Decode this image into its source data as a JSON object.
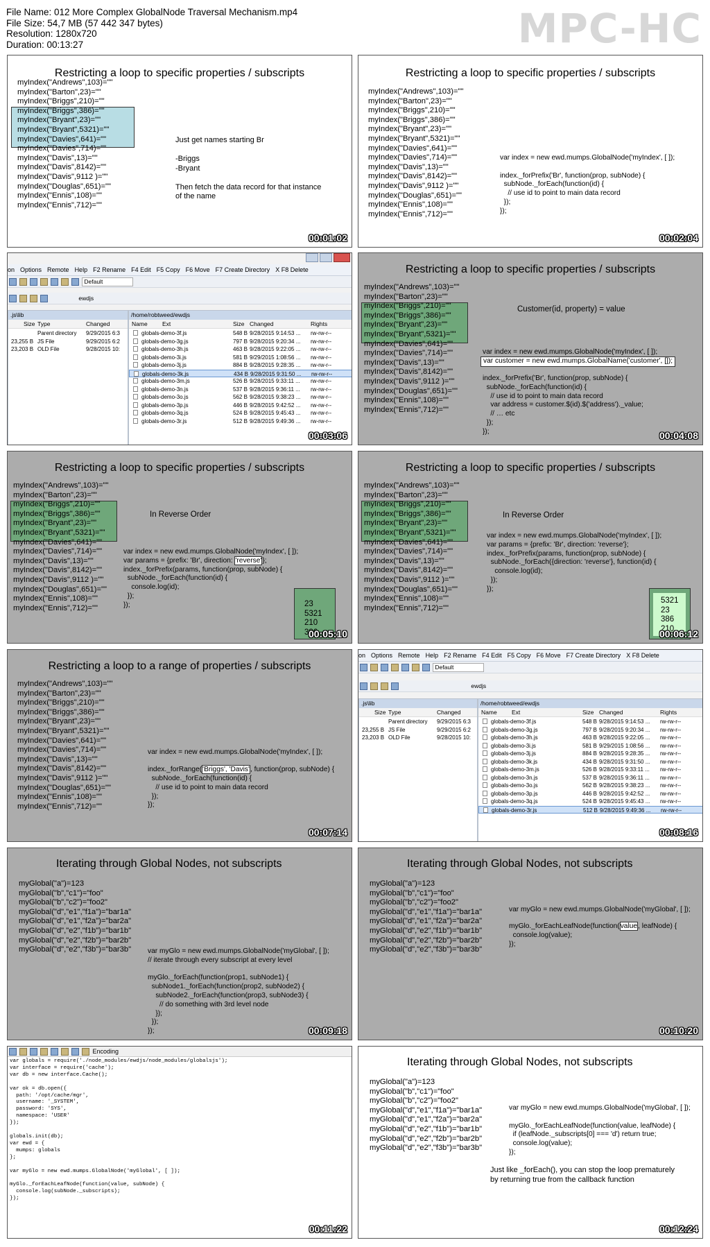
{
  "header": {
    "file_name": "File Name: 012 More Complex GlobalNode Traversal Mechanism.mp4",
    "file_size": "File Size: 54,7 MB (57 442 347 bytes)",
    "resolution": "Resolution: 1280x720",
    "duration": "Duration: 00:13:27",
    "logo": "MPC-HC"
  },
  "index_lines": [
    "myIndex(\"Andrews\",103)=\"\"",
    "myIndex(\"Barton\",23)=\"\"",
    "myIndex(\"Briggs\",210)=\"\"",
    "myIndex(\"Briggs\",386)=\"\"",
    "myIndex(\"Bryant\",23)=\"\"",
    "myIndex(\"Bryant\",5321)=\"\"",
    "myIndex(\"Davies\",641)=\"\"",
    "myIndex(\"Davies\",714)=\"\"",
    "myIndex(\"Davis\",13)=\"\"",
    "myIndex(\"Davis\",8142)=\"\"",
    "myIndex(\"Davis\",9112 )=\"\"",
    "myIndex(\"Douglas\",651)=\"\"",
    "myIndex(\"Ennis\",108)=\"\"",
    "myIndex(\"Ennis\",712)=\"\""
  ],
  "global_lines": [
    "myGlobal(\"a\")=123",
    "myGlobal(\"b\",\"c1\")=\"foo\"",
    "myGlobal(\"b\",\"c2\")=\"foo2\"",
    "myGlobal(\"d\",\"e1\",\"f1a\")=\"bar1a\"",
    "myGlobal(\"d\",\"e1\",\"f2a\")=\"bar2a\"",
    "myGlobal(\"d\",\"e2\",\"f1b\")=\"bar1b\"",
    "myGlobal(\"d\",\"e2\",\"f2b\")=\"bar2b\"",
    "myGlobal(\"d\",\"e2\",\"f3b\")=\"bar3b\""
  ],
  "titles": {
    "restrict": "Restricting a loop to specific properties / subscripts",
    "range": "Restricting a loop to a range of properties / subscripts",
    "iterate": "Iterating through Global Nodes, not subscripts"
  },
  "t1": {
    "note": "Just get names starting Br\n\n-Briggs\n-Bryant\n\nThen fetch the data record for that instance\nof the name",
    "time": "00:01:02"
  },
  "t2": {
    "code": "var index = new ewd.mumps.GlobalNode('myIndex', [ ]);\n\nindex._forPrefix('Br', function(prop, subNode) {\n  subNode._forEach(function(id) {\n    // use id to point to main data record\n  });\n});",
    "time": "00:02:04"
  },
  "t3": {
    "menu": [
      "on",
      "Options",
      "Remote",
      "Help",
      "F2 Rename",
      "F4 Edit",
      "F5 Copy",
      "F6 Move",
      "F7 Create Directory",
      "X F8 Delete"
    ],
    "profile": "Default",
    "left_path": ".js\\lib",
    "right_path": "/home/robtweed/ewdjs",
    "right_folder": "ewdjs",
    "left_cols": [
      "Size",
      "Type",
      "Changed"
    ],
    "left_rows": [
      [
        "",
        "Parent directory",
        "9/29/2015 6:3"
      ],
      [
        "23,255 B",
        "JS File",
        "9/29/2015 6:2"
      ],
      [
        "23,203 B",
        "OLD File",
        "9/28/2015 10:"
      ]
    ],
    "right_cols": [
      "Name",
      "Ext",
      "Size",
      "Changed",
      "Rights"
    ],
    "right_rows": [
      [
        "globals-demo-3f.js",
        "548 B",
        "9/28/2015 9:14:53 ...",
        "rw-rw-r--"
      ],
      [
        "globals-demo-3g.js",
        "797 B",
        "9/28/2015 9:20:34 ...",
        "rw-rw-r--"
      ],
      [
        "globals-demo-3h.js",
        "463 B",
        "9/28/2015 9:22:05 ...",
        "rw-rw-r--"
      ],
      [
        "globals-demo-3i.js",
        "581 B",
        "9/29/2015 1:08:56 ...",
        "rw-rw-r--"
      ],
      [
        "globals-demo-3j.js",
        "884 B",
        "9/28/2015 9:28:35 ...",
        "rw-rw-r--"
      ],
      [
        "globals-demo-3k.js",
        "434 B",
        "9/28/2015 9:31:50 ...",
        "rw-rw-r--"
      ],
      [
        "globals-demo-3m.js",
        "526 B",
        "9/28/2015 9:33:11 ...",
        "rw-rw-r--"
      ],
      [
        "globals-demo-3n.js",
        "537 B",
        "9/28/2015 9:36:11 ...",
        "rw-rw-r--"
      ],
      [
        "globals-demo-3o.js",
        "562 B",
        "9/28/2015 9:38:23 ...",
        "rw-rw-r--"
      ],
      [
        "globals-demo-3p.js",
        "446 B",
        "9/28/2015 9:42:52 ...",
        "rw-rw-r--"
      ],
      [
        "globals-demo-3q.js",
        "524 B",
        "9/28/2015 9:45:43 ...",
        "rw-rw-r--"
      ],
      [
        "globals-demo-3r.js",
        "512 B",
        "9/28/2015 9:49:36 ...",
        "rw-rw-r--"
      ]
    ],
    "time": "00:03:06"
  },
  "t4": {
    "formula": "Customer(id, property) = value",
    "code1": "var index = new ewd.mumps.GlobalNode('myIndex', [ ]);",
    "code2": "var customer = new ewd.mumps.GlobalName('customer', []);",
    "code3": "index._forPrefix('Br', function(prop, subNode) {\n  subNode._forEach(function(id) {\n    // use id to point to main data record\n    var address = customer.$(id).$('address')._value;\n    // … etc\n  });\n});",
    "time": "00:04:08"
  },
  "t5": {
    "label": "In Reverse Order",
    "code_a": "var index = new ewd.mumps.GlobalNode('myIndex', [ ]);\nvar params = {prefix: 'Br', direction: ",
    "code_hl": "'reverse'",
    "code_b": "};\nindex._forPrefix(params, function(prop, subNode) {\n  subNode._forEach(function(id) {\n    console.log(id);\n  });\n});",
    "results": "23\n5321\n210\n386",
    "time": "00:05:10"
  },
  "t6": {
    "label": "In Reverse Order",
    "code": "var index = new ewd.mumps.GlobalNode('myIndex', [ ]);\nvar params = {prefix: 'Br', direction: 'reverse'};\nindex._forPrefix(params, function(prop, subNode) {\n  subNode._forEach({direction: 'reverse'}, function(id) {\n    console.log(id);\n  });\n});",
    "results": "5321\n23\n386\n210",
    "time": "00:06:12"
  },
  "t7": {
    "code1": "var index = new ewd.mumps.GlobalNode('myIndex', [ ]);",
    "code2_a": "index._forRange(",
    "code2_hl": "'Briggs', 'Davis'",
    "code2_b": ", function(prop, subNode) {",
    "code3": "  subNode._forEach(function(id) {\n    // use id to point to main data record\n  });\n});",
    "time": "00:07:14"
  },
  "t8": {
    "time": "00:08:16"
  },
  "t9": {
    "code": "var myGlo = new ewd.mumps.GlobalNode('myGlobal', [ ]);\n// iterate through every subscript at every level\n\nmyGlo._forEach(function(prop1, subNode1) {\n  subNode1._forEach(function(prop2, subNode2) {\n    subNode2._forEach(function(prop3, subNode3) {\n      // do something with 3rd level node\n    });\n  });\n});",
    "time": "00:09:18"
  },
  "t10": {
    "code1": "var myGlo = new ewd.mumps.GlobalNode('myGlobal', [ ]);",
    "code2_a": "myGlo._forEachLeafNode(function(",
    "code2_hl": "value",
    "code2_b": ", leafNode) {",
    "code3": "  console.log(value);\n});",
    "time": "00:10:20"
  },
  "t11": {
    "toolbar_label": "Encoding",
    "code": "var globals = require('./node_modules/ewdjs/node_modules/globalsjs');\nvar interface = require('cache');\nvar db = new interface.Cache();\n\nvar ok = db.open({\n  path: '/opt/cache/mgr',\n  username: '_SYSTEM',\n  password: 'SYS',\n  namespace: 'USER'\n});\n\nglobals.init(db);\nvar ewd = {\n  mumps: globals\n};\n\nvar myGlo = new ewd.mumps.GlobalNode('myGlobal', [ ]);\n\nmyGlo._forEachLeafNode(function(value, subNode) {\n  console.log(subNode._subscripts);\n});",
    "time": "00:11:22"
  },
  "t12": {
    "code": "var myGlo = new ewd.mumps.GlobalNode('myGlobal', [ ]);\n\nmyGlo._forEachLeafNode(function(value, leafNode) {\n  if (leafNode._subscripts[0] === 'd') return true;\n  console.log(value);\n});",
    "note": "Just like _forEach(), you can stop the loop prematurely\nby returning true from the callback function",
    "time": "00:12:24"
  }
}
